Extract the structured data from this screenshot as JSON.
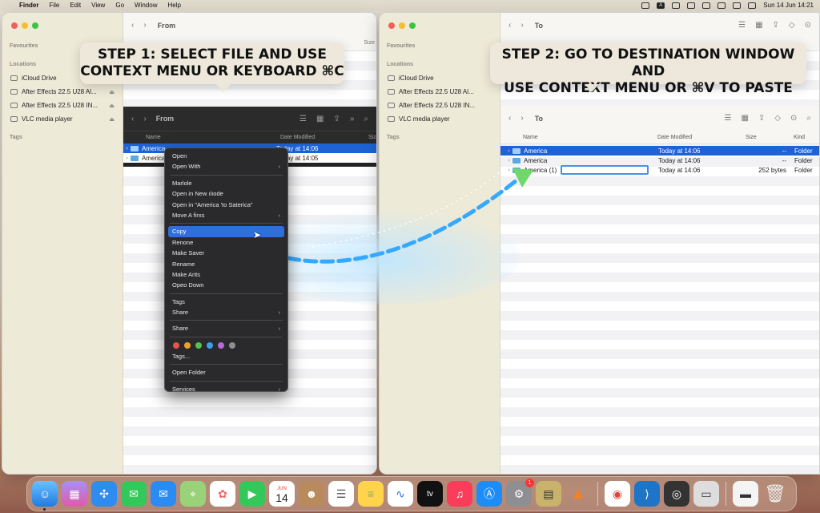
{
  "menubar": {
    "app": "Finder",
    "menus": [
      "File",
      "Edit",
      "View",
      "Go",
      "Window",
      "Help"
    ],
    "input_source": "A",
    "datetime": "Sun 14 Jun  14:21"
  },
  "left_window": {
    "title": "From",
    "sidebar": {
      "favourites_header": "Favourites",
      "locations_header": "Locations",
      "locations": [
        "iCloud Drive",
        "After Effects 22.5 U28 Al...",
        "After Effects 22.5 U28 IN..."
      ],
      "other": "VLC media player",
      "tags_header": "Tags"
    },
    "size_col_fragment": "Size",
    "inner_title": "From",
    "columns": {
      "name": "Name",
      "date": "Date Modified",
      "size": "Siz"
    },
    "rows": [
      {
        "name": "America",
        "date": "Today at 14:06",
        "selected": true
      },
      {
        "name": "America",
        "date": "Today at 14:05",
        "selected": false
      }
    ]
  },
  "context_menu": {
    "group1": [
      "Open",
      "Open With"
    ],
    "group2": [
      "Marlole",
      "Open in New ılıode",
      "Open in \"America 'to Saterica\"",
      "Move A firxs"
    ],
    "group3": [
      "Copy",
      "Renone",
      "Make Saver",
      "Rename",
      "Make Arits",
      "Opeo Down"
    ],
    "group4": [
      "Tags",
      "Share"
    ],
    "share": "Share",
    "tag_colors": [
      "#e5534b",
      "#f0a02c",
      "#58c04b",
      "#3aa1e8",
      "#b66ad6",
      "#8e8e93"
    ],
    "tags_ellipsis": "Tags...",
    "open_folder": "Open Folder",
    "services": "Services",
    "highlighted": "Copy"
  },
  "right_window": {
    "title": "To",
    "sidebar": {
      "favourites_header": "Favourites",
      "locations_header": "Locations",
      "locations": [
        "iCloud Drive",
        "After Effects 22.5 U28 Al...",
        "After Effects 22.5 U28 IN..."
      ],
      "other": "VLC media player",
      "tags_header": "Tags"
    },
    "inner_title": "To",
    "columns": {
      "name": "Name",
      "date": "Date Modified",
      "size": "Size",
      "kind": "Kind"
    },
    "rows": [
      {
        "name": "America",
        "date": "Today at 14:06",
        "size": "--",
        "kind": "Folder",
        "selected": true
      },
      {
        "name": "America",
        "date": "Today at 14:06",
        "size": "--",
        "kind": "Folder",
        "selected": false
      },
      {
        "name": "America (1)",
        "date": "Today at 14:06",
        "size": "252 bytes",
        "kind": "Folder",
        "selected": false
      }
    ]
  },
  "callouts": {
    "step1_line1": "STEP 1: SELECT FILE AND USE",
    "step1_line2": "CONTEXT MENU OR KEYBOARD ⌘C",
    "step2_line1": "STEP 2: GO TO DESTINATION WINDOW AND",
    "step2_line2": "USE CONTEXT MENU OR ⌘V TO PASTE"
  },
  "dock": {
    "calendar_month": "JUN",
    "calendar_day": "14",
    "tv_label": "tv",
    "settings_badge": "1"
  },
  "colors": {
    "selection": "#1d63d6",
    "sidebar": "#eeead8",
    "callout_bg": "#ece7da"
  }
}
